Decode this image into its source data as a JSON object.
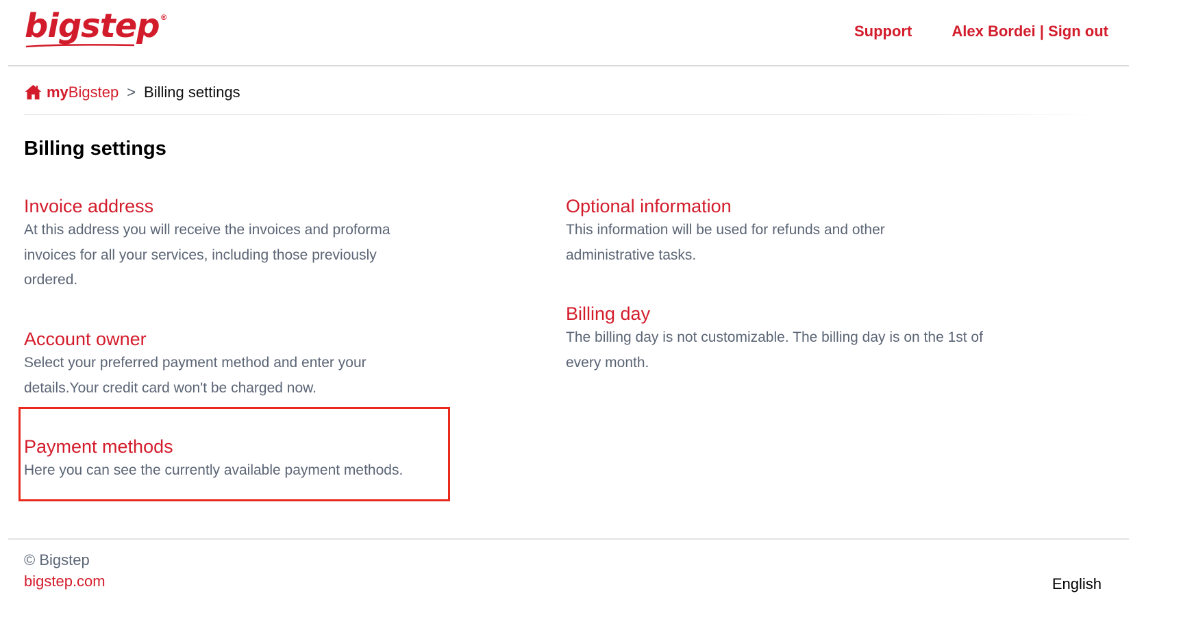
{
  "header": {
    "logo_text": "bigstep",
    "logo_reg": "®",
    "support_label": "Support",
    "user_name": "Alex Bordei",
    "user_separator": " | ",
    "signout_label": "Sign out"
  },
  "breadcrumb": {
    "home_prefix": "my",
    "home_brand": "Bigstep",
    "separator": ">",
    "current": "Billing settings"
  },
  "page_title": "Billing settings",
  "sections": {
    "invoice_address": {
      "title": "Invoice address",
      "description": "At this address you will receive the invoices and proforma invoices for all your services, including those previously ordered."
    },
    "account_owner": {
      "title": "Account owner",
      "description": "Select your preferred payment method and enter your details.Your credit card won't be charged now."
    },
    "payment_methods": {
      "title": "Payment methods",
      "description": "Here you can see the currently available payment methods."
    },
    "optional_information": {
      "title": "Optional information",
      "description": "This information will be used for refunds and other administrative tasks."
    },
    "billing_day": {
      "title": "Billing day",
      "description": "The billing day is not customizable. The billing day is on the 1st of every month."
    }
  },
  "footer": {
    "copyright": "© Bigstep",
    "site_link": "bigstep.com",
    "language": "English"
  },
  "colors": {
    "brand_red": "#d31c2b",
    "highlight_red": "#e8291c",
    "body_text": "#5b6575"
  }
}
